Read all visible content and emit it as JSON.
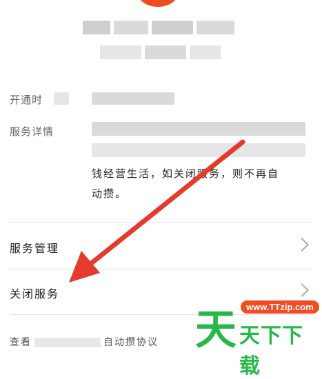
{
  "info": {
    "open_time_label": "开通时",
    "service_detail_label": "服务详情",
    "description_line1": "钱经营生活，如关闭服务，则不再自",
    "description_line2": "动攒。"
  },
  "menu": {
    "service_manage": "服务管理",
    "close_service": "关闭服务"
  },
  "footer": {
    "prefix": "查看",
    "suffix": "自动攒协议"
  },
  "watermark": {
    "glyph": "天",
    "url": "www.TTzip.com",
    "text": "天下下载"
  },
  "colors": {
    "accent": "#f04d22",
    "watermark_green": "#27b84a",
    "arrow_red": "#e53a2c"
  }
}
